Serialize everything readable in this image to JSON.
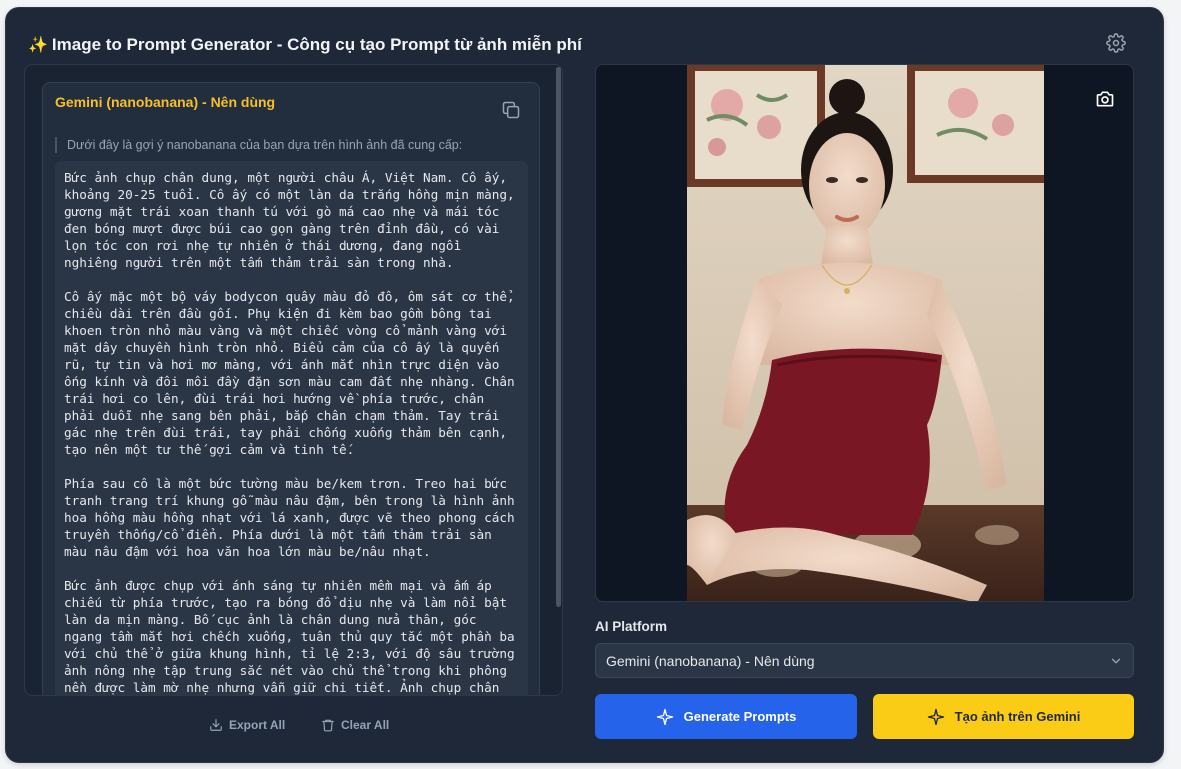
{
  "header": {
    "title_icon": "sparkles-icon",
    "title": "Image to Prompt Generator - Công cụ tạo Prompt từ ảnh miễn phí",
    "settings_icon": "gear-icon"
  },
  "result": {
    "platform_title": "Gemini (nanobanana) - Nên dùng",
    "copy_icon": "copy-icon",
    "intro": "Dưới đây là gợi ý nanobanana của bạn dựa trên hình ảnh đã cung cấp:",
    "prompt": "Bức ảnh chụp chân dung, một người châu Á, Việt Nam. Cô ấy, khoảng 20-25 tuổi. Cô ấy có một làn da trắng hồng mịn màng, gương mặt trái xoan thanh tú với gò má cao nhẹ và mái tóc đen bóng mượt được búi cao gọn gàng trên đỉnh đầu, có vài lọn tóc con rơi nhẹ tự nhiên ở thái dương, đang ngồi nghiêng người trên một tấm thảm trải sàn trong nhà.\n\nCô ấy mặc một bộ váy bodycon quây màu đỏ đô, ôm sát cơ thể, chiều dài trên đầu gối. Phụ kiện đi kèm bao gồm bông tai khoen tròn nhỏ màu vàng và một chiếc vòng cổ mảnh vàng với mặt dây chuyền hình tròn nhỏ. Biểu cảm của cô ấy là quyến rũ, tự tin và hơi mơ màng, với ánh mắt nhìn trực diện vào ống kính và đôi môi đầy đặn sơn màu cam đất nhẹ nhàng. Chân trái hơi co lên, đùi trái hơi hướng về phía trước, chân phải duỗi nhẹ sang bên phải, bắp chân chạm thảm. Tay trái gác nhẹ trên đùi trái, tay phải chống xuống thảm bên cạnh, tạo nên một tư thế gợi cảm và tinh tế.\n\nPhía sau cô là một bức tường màu be/kem trơn. Treo hai bức tranh trang trí khung gỗ màu nâu đậm, bên trong là hình ảnh hoa hồng màu hồng nhạt với lá xanh, được vẽ theo phong cách truyền thống/cổ điển. Phía dưới là một tấm thảm trải sàn màu nâu đậm với hoa văn hoa lớn màu be/nâu nhạt.\n\nBức ảnh được chụp với ánh sáng tự nhiên mềm mại và ấm áp chiếu từ phía trước, tạo ra bóng đổ dịu nhẹ và làm nổi bật làn da mịn màng. Bố cục ảnh là chân dung nửa thân, góc ngang tầm mắt hơi chếch xuống, tuân thủ quy tắc một phần ba với chủ thể ở giữa khung hình, tỉ lệ 2:3, với độ sâu trường ảnh nông nhẹ tập trung sắc nét vào chủ thể trong khi phông nền được làm mờ nhẹ nhưng vẫn giữ chi tiết. Ảnh chụp chân"
  },
  "footer": {
    "export_label": "Export All",
    "export_icon": "download-icon",
    "clear_label": "Clear All",
    "clear_icon": "trash-icon"
  },
  "preview": {
    "image_icon": "portrait-photo",
    "camera_icon": "camera-icon"
  },
  "platform": {
    "label": "AI Platform",
    "selected": "Gemini (nanobanana) - Nên dùng",
    "chevron_icon": "chevron-down-icon"
  },
  "actions": {
    "generate_label": "Generate Prompts",
    "gemini_label": "Tạo ảnh trên Gemini",
    "sparkle_icon": "sparkle-icon"
  },
  "colors": {
    "background": "#1e2838",
    "accent_blue": "#2563eb",
    "accent_yellow": "#facc15",
    "title_yellow": "#f6c026"
  }
}
